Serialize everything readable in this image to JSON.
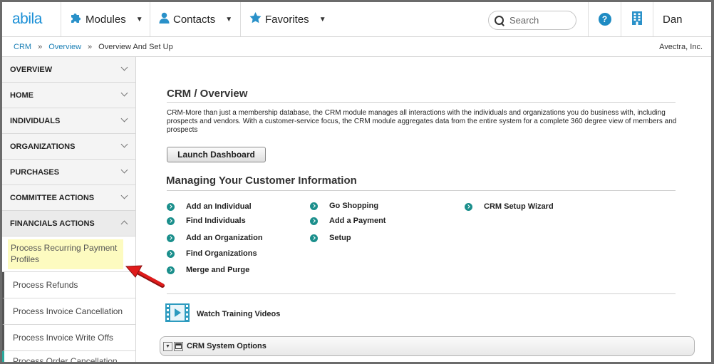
{
  "topbar": {
    "logo": "abila",
    "modules_label": "Modules",
    "contacts_label": "Contacts",
    "favorites_label": "Favorites",
    "search_placeholder": "Search",
    "help_label": "?",
    "user_name": "Dan"
  },
  "breadcrumb": {
    "items": [
      "CRM",
      "Overview"
    ],
    "separator": "»",
    "current": "Overview And Set Up",
    "company": "Avectra, Inc."
  },
  "sidebar": {
    "sections": [
      {
        "label": "OVERVIEW"
      },
      {
        "label": "HOME"
      },
      {
        "label": "INDIVIDUALS"
      },
      {
        "label": "ORGANIZATIONS"
      },
      {
        "label": "PURCHASES"
      },
      {
        "label": "COMMITTEE ACTIONS"
      },
      {
        "label": "FINANCIALS ACTIONS"
      }
    ],
    "sub_items": [
      {
        "label": "Process Recurring Payment Profiles"
      },
      {
        "label": "Process Refunds"
      },
      {
        "label": "Process Invoice Cancellation"
      },
      {
        "label": "Process Invoice Write Offs"
      },
      {
        "label": "Process Order Cancellation"
      }
    ]
  },
  "main": {
    "title": "CRM / Overview",
    "description": "CRM-More than just a membership database, the CRM module manages all interactions with the individuals and organizations you do business with, including prospects and vendors. With a customer-service focus, the CRM module aggregates data from the entire system for a complete 360 degree view of members and prospects",
    "launch_button": "Launch Dashboard",
    "section_title": "Managing Your Customer Information",
    "links_col1": [
      "Add an Individual",
      "Find Individuals",
      "Add an Organization",
      "Find Organizations",
      "Merge and Purge"
    ],
    "links_col2": [
      "Go Shopping",
      "Add a Payment",
      "Setup"
    ],
    "links_col3": [
      "CRM Setup Wizard"
    ],
    "video_label": "Watch Training Videos",
    "system_options_label": "CRM System Options",
    "collapse_glyph": "▼"
  },
  "colors": {
    "brand_blue": "#1a8fd6",
    "link_teal": "#1b8f8c",
    "highlight_yellow": "#fdfbc0",
    "annotation_red": "#e01b1b"
  }
}
